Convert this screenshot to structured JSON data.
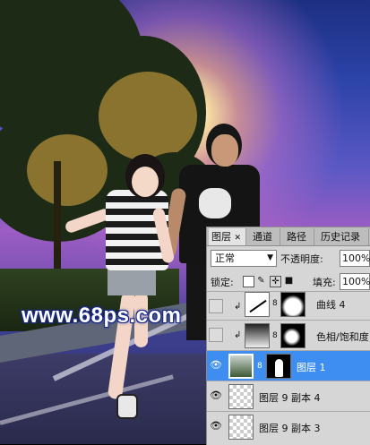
{
  "watermark": "www.68ps.com",
  "panel": {
    "tabs": [
      "图层",
      "通道",
      "路径",
      "历史记录"
    ],
    "close_glyph": "✕",
    "blend_mode": "正常",
    "opacity_label": "不透明度:",
    "opacity_value": "100%",
    "lock_label": "锁定:",
    "fill_label": "填充:",
    "fill_value": "100%",
    "layers": [
      {
        "name": "曲线 4",
        "visible": false,
        "selected": false
      },
      {
        "name": "色相/饱和度",
        "visible": false,
        "selected": false
      },
      {
        "name": "图层 1",
        "visible": true,
        "selected": true
      },
      {
        "name": "图层 9 副本 4",
        "visible": true,
        "selected": false
      },
      {
        "name": "图层 9 副本 3",
        "visible": true,
        "selected": false
      }
    ]
  },
  "icons": {
    "eye": "👁",
    "link": "8",
    "clip_arrow": "↲"
  },
  "colors": {
    "selection": "#3d8ef0",
    "watermark_outline": "#1b2a8a"
  }
}
